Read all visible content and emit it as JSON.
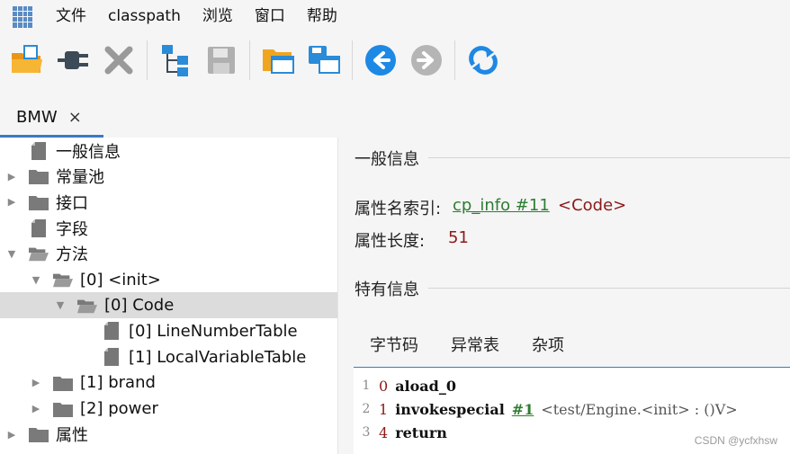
{
  "menu": [
    "文件",
    "classpath",
    "浏览",
    "窗口",
    "帮助"
  ],
  "toolbar": {
    "buttons": [
      {
        "name": "open-icon",
        "color": "#f0a520"
      },
      {
        "name": "plug-icon",
        "color": "#3d4a57"
      },
      {
        "name": "close-icon",
        "color": "#9a9a9a"
      },
      {
        "name": "tree-icon",
        "color": "#2a8bd8"
      },
      {
        "name": "save-icon",
        "color": "#b0b0b0"
      },
      {
        "name": "folder-window-icon",
        "color": "#f0a520"
      },
      {
        "name": "save-window-icon",
        "color": "#2a8bd8"
      },
      {
        "name": "back-icon",
        "color": "#1e88e5"
      },
      {
        "name": "forward-icon",
        "color": "#b5b5b5"
      },
      {
        "name": "refresh-icon",
        "color": "#1e88e5"
      }
    ]
  },
  "tab": {
    "label": "BMW",
    "close": "×"
  },
  "tree": [
    {
      "label": "一般信息",
      "indent": 0,
      "arrow": "",
      "icon": "file"
    },
    {
      "label": "常量池",
      "indent": 0,
      "arrow": "▶",
      "icon": "folder"
    },
    {
      "label": "接口",
      "indent": 0,
      "arrow": "▶",
      "icon": "folder"
    },
    {
      "label": "字段",
      "indent": 0,
      "arrow": "",
      "icon": "file"
    },
    {
      "label": "方法",
      "indent": 0,
      "arrow": "▼",
      "icon": "folder-open"
    },
    {
      "label": "[0] <init>",
      "indent": 1,
      "arrow": "▼",
      "icon": "folder-open"
    },
    {
      "label": "[0] Code",
      "indent": 2,
      "arrow": "▼",
      "icon": "folder-open",
      "selected": true
    },
    {
      "label": "[0] LineNumberTable",
      "indent": 3,
      "arrow": "",
      "icon": "file"
    },
    {
      "label": "[1] LocalVariableTable",
      "indent": 3,
      "arrow": "",
      "icon": "file"
    },
    {
      "label": "[1] brand",
      "indent": 1,
      "arrow": "▶",
      "icon": "folder"
    },
    {
      "label": "[2] power",
      "indent": 1,
      "arrow": "▶",
      "icon": "folder"
    },
    {
      "label": "属性",
      "indent": 0,
      "arrow": "▶",
      "icon": "folder"
    }
  ],
  "general": {
    "title": "一般信息",
    "name_index_label": "属性名索引:",
    "name_index_link": "cp_info #11",
    "name_index_value": "<Code>",
    "length_label": "属性长度:",
    "length_value": "51"
  },
  "specific": {
    "title": "特有信息"
  },
  "subtabs": [
    "字节码",
    "异常表",
    "杂项"
  ],
  "code": [
    {
      "ln": "1",
      "offset": "0",
      "op": "aload_0",
      "ref": "",
      "comment": ""
    },
    {
      "ln": "2",
      "offset": "1",
      "op": "invokespecial",
      "ref": "#1",
      "comment": "<test/Engine.<init> : ()V>"
    },
    {
      "ln": "3",
      "offset": "4",
      "op": "return",
      "ref": "",
      "comment": ""
    }
  ],
  "watermark": "CSDN @ycfxhsw"
}
